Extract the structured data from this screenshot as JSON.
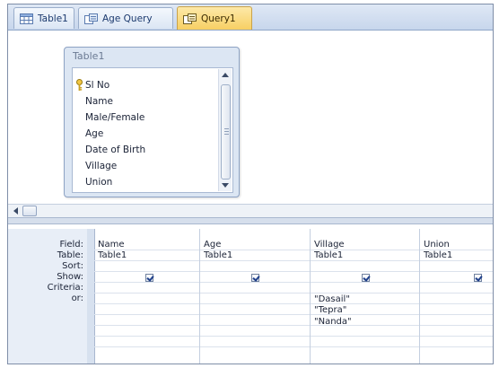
{
  "tabs": [
    {
      "label": "Table1",
      "icon": "table-icon",
      "active": false
    },
    {
      "label": "Age Query",
      "icon": "query-icon",
      "active": false
    },
    {
      "label": "Query1",
      "icon": "query-icon",
      "active": true
    }
  ],
  "field_list": {
    "title": "Table1",
    "items": [
      "Sl No",
      "Name",
      "Male/Female",
      "Age",
      "Date of Birth",
      "Village",
      "Union"
    ],
    "key_field_index": 0
  },
  "grid": {
    "row_labels": [
      "Field:",
      "Table:",
      "Sort:",
      "Show:",
      "Criteria:",
      "or:"
    ],
    "columns": [
      {
        "field": "Name",
        "table": "Table1",
        "sort": "",
        "show": true,
        "criteria": [],
        "width": 0
      },
      {
        "field": "Age",
        "table": "Table1",
        "sort": "",
        "show": true,
        "criteria": []
      },
      {
        "field": "Village",
        "table": "Table1",
        "sort": "",
        "show": true,
        "criteria": [
          "\"Dasail\"",
          "\"Tepra\"",
          "\"Nanda\""
        ]
      },
      {
        "field": "Union",
        "table": "Table1",
        "sort": "",
        "show": true,
        "criteria": []
      }
    ]
  },
  "colors": {
    "active_tab": "#f7cf63",
    "grid_border": "#a8b7cf",
    "checkbox_mark": "#1f3f8a"
  }
}
